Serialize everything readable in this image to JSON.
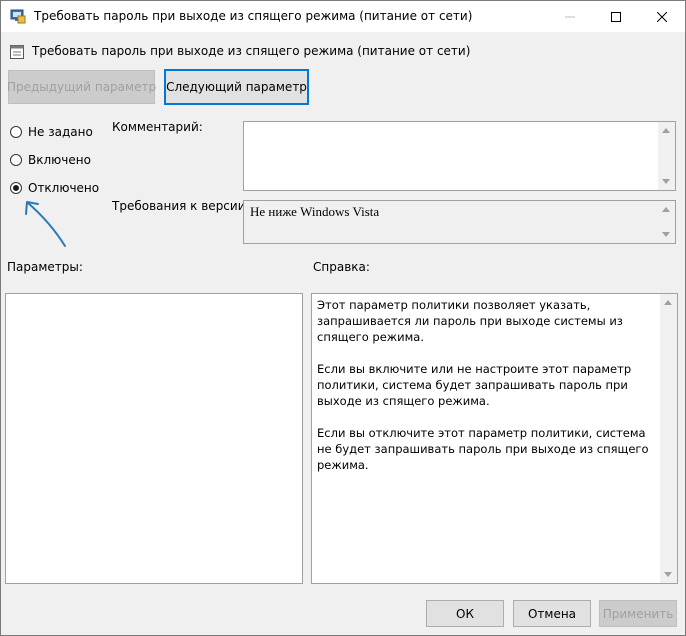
{
  "window": {
    "title": "Требовать пароль при выходе из спящего режима (питание от сети)"
  },
  "header": {
    "setting_name": "Требовать пароль при выходе из спящего режима (питание от сети)"
  },
  "navigation": {
    "prev_label": "Предыдущий параметр",
    "next_label": "Следующий параметр"
  },
  "state_options": [
    {
      "label": "Не задано",
      "checked": false
    },
    {
      "label": "Включено",
      "checked": false
    },
    {
      "label": "Отключено",
      "checked": true
    }
  ],
  "comment": {
    "label": "Комментарий:",
    "value": ""
  },
  "supported_on": {
    "label": "Требования к версии:",
    "value": "Не ниже Windows Vista"
  },
  "options_panel": {
    "label": "Параметры:"
  },
  "help_panel": {
    "label": "Справка:",
    "paragraphs": [
      "Этот параметр политики позволяет указать, запрашивается ли пароль при выходе системы из спящего режима.",
      "Если вы включите или не настроите этот параметр политики, система будет запрашивать пароль при выходе из спящего режима.",
      "Если вы отключите этот параметр политики, система не будет запрашивать пароль при выходе из спящего режима."
    ]
  },
  "footer": {
    "ok_label": "ОК",
    "cancel_label": "Отмена",
    "apply_label": "Применить"
  },
  "colors": {
    "annotation_arrow": "#2a7ab8",
    "default_button_border": "#0078d7"
  }
}
